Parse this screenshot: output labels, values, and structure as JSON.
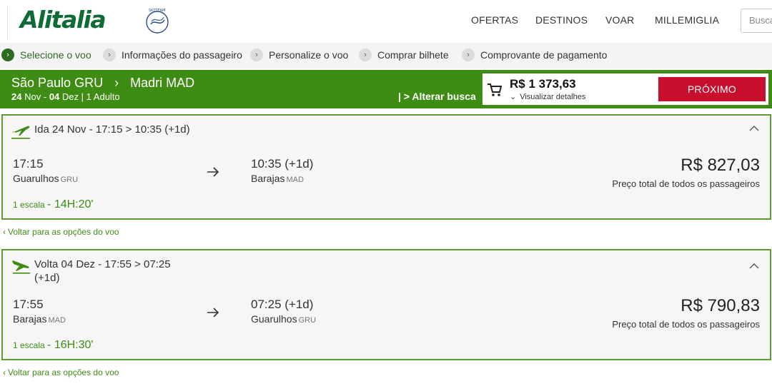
{
  "brand": {
    "name": "Alitalia",
    "accent": "#3e8c13",
    "cta": "#c8102e"
  },
  "nav": {
    "items": [
      "OFERTAS",
      "DESTINOS",
      "VOAR",
      "MILLEMIGLIA"
    ],
    "search_placeholder": "Busca"
  },
  "steps": [
    {
      "label": "Selecione o voo",
      "active": true
    },
    {
      "label": "Informações do passageiro",
      "active": false
    },
    {
      "label": "Personalize o voo",
      "active": false
    },
    {
      "label": "Comprar bilhete",
      "active": false
    },
    {
      "label": "Comprovante de pagamento",
      "active": false
    }
  ],
  "summary": {
    "origin": "São Paulo GRU",
    "destination": "Madri MAD",
    "depart_date": "24",
    "depart_month": "Nov",
    "return_date": "04",
    "return_month": "Dez",
    "passengers": "1 Adulto",
    "change_search": "| > Alterar busca",
    "total": "R$ 1 373,63",
    "details": "Visualizar detalhes",
    "next_button": "PRÓXIMO"
  },
  "flights": [
    {
      "title": "Ida 24 Nov - 17:15 > 10:35 (+1d)",
      "dep_time": "17:15",
      "dep_airport": "Guarulhos",
      "dep_code": "GRU",
      "arr_time": "10:35 (+1d)",
      "arr_airport": "Barajas",
      "arr_code": "MAD",
      "price": "R$ 827,03",
      "price_note": "Preço total de todos os passageiros",
      "stops": "1 escala",
      "duration": "- 14H:20'"
    },
    {
      "title": "Volta 04 Dez - 17:55 > 07:25",
      "title_line2": "(+1d)",
      "dep_time": "17:55",
      "dep_airport": "Barajas",
      "dep_code": "MAD",
      "arr_time": "07:25 (+1d)",
      "arr_airport": "Guarulhos",
      "arr_code": "GRU",
      "price": "R$ 790,83",
      "price_note": "Preço total de todos os passageiros",
      "stops": "1 escala",
      "duration": "- 16H:30'"
    }
  ],
  "back_link": "Voltar para as opções do voo",
  "icons": {
    "cart": "shopping-cart-icon",
    "takeoff": "airplane-takeoff-icon",
    "landing": "airplane-landing-icon",
    "collapse": "chevron-up-icon",
    "arrow": "arrow-right-icon"
  }
}
